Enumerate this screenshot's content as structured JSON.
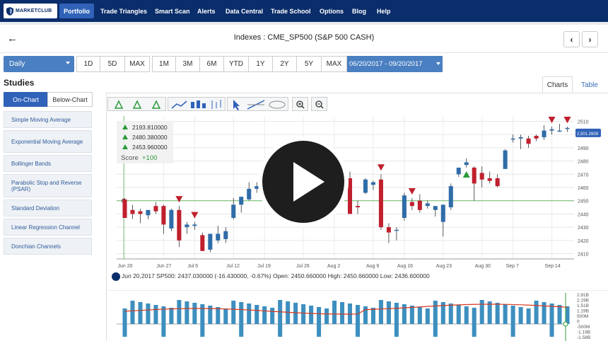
{
  "nav": {
    "logo": "MARKETCLUB",
    "items": [
      {
        "label": "Portfolio",
        "active": true
      },
      {
        "label": "Trade Triangles",
        "active": false
      },
      {
        "label": "Smart Scan",
        "active": false
      },
      {
        "label": "Alerts",
        "active": false
      },
      {
        "label": "Data Central",
        "active": false
      },
      {
        "label": "Trade School",
        "active": false
      },
      {
        "label": "Options",
        "active": false
      },
      {
        "label": "Blog",
        "active": false
      },
      {
        "label": "Help",
        "active": false
      }
    ]
  },
  "header": {
    "back_icon": "←",
    "title": "Indexes : CME_SP500 (S&P 500 CASH)",
    "prev_icon": "‹",
    "next_icon": "›"
  },
  "period": {
    "selected": "Daily",
    "intraday": [
      "1D",
      "5D",
      "MAX"
    ],
    "ranges": [
      "1M",
      "3M",
      "6M",
      "YTD",
      "1Y",
      "2Y",
      "5Y",
      "MAX"
    ],
    "date_range": "06/20/2017 - 09/20/2017"
  },
  "studies": {
    "title": "Studies",
    "tabs": [
      "On-Chart",
      "Below-Chart"
    ],
    "items": [
      "Simple Moving Average",
      "Exponential Moving Average",
      "Bollinger Bands",
      "Parabolic Stop and Reverse (PSAR)",
      "Standard Deviation",
      "Linear Regression Channel",
      "Donchian Channels"
    ]
  },
  "views": {
    "charts": "Charts",
    "table": "Table"
  },
  "legend": {
    "values": [
      "2193.810000",
      "2480.380000",
      "2453.960000"
    ],
    "score_label": "Score",
    "score_value": "+100"
  },
  "info_line": "Jun 20,2017 SP500: 2437.030000 (-16.430000, -0.67%) Open: 2450.660000 High: 2450.660000 Low: 2436.600000",
  "colors": {
    "nav_bg": "#0a2d6b",
    "accent": "#2f62b8",
    "select_bg": "#4a7fc1",
    "up": "#2f6da8",
    "down": "#c0202e",
    "signal_green": "#2c9a3a"
  },
  "chart_data": {
    "type": "candlestick",
    "x_ticks": [
      "Jun 20",
      "Jun 27",
      "Jul 5",
      "Jul 12",
      "Jul 19",
      "Jul 26",
      "Aug 2",
      "Aug 9",
      "Aug 16",
      "Aug 23",
      "Aug 30",
      "Sep 7",
      "Sep 14"
    ],
    "y_ticks": [
      2410,
      2420,
      2430,
      2440,
      2450,
      2460,
      2470,
      2480,
      2490,
      2500,
      2510
    ],
    "ylim": [
      2406,
      2514
    ],
    "last_price_label": "2,501.2609",
    "horizontal_line": 2450,
    "candles": [
      {
        "o": 2451,
        "h": 2452,
        "l": 2437,
        "c": 2437
      },
      {
        "o": 2443,
        "h": 2447,
        "l": 2436,
        "c": 2440
      },
      {
        "o": 2442,
        "h": 2444,
        "l": 2433,
        "c": 2440
      },
      {
        "o": 2439,
        "h": 2441,
        "l": 2436,
        "c": 2443
      },
      {
        "o": 2446,
        "h": 2449,
        "l": 2440,
        "c": 2442
      },
      {
        "o": 2446,
        "h": 2447,
        "l": 2425,
        "c": 2432
      },
      {
        "o": 2429,
        "h": 2444,
        "l": 2427,
        "c": 2443
      },
      {
        "o": 2443,
        "h": 2446,
        "l": 2415,
        "c": 2420
      },
      {
        "o": 2430,
        "h": 2434,
        "l": 2425,
        "c": 2432
      },
      {
        "o": 2431,
        "h": 2434,
        "l": 2428,
        "c": 2432
      },
      {
        "o": 2424,
        "h": 2426,
        "l": 2412,
        "c": 2412
      },
      {
        "o": 2413,
        "h": 2425,
        "l": 2411,
        "c": 2425
      },
      {
        "o": 2420,
        "h": 2431,
        "l": 2418,
        "c": 2425
      },
      {
        "o": 2421,
        "h": 2430,
        "l": 2418,
        "c": 2427
      },
      {
        "o": 2437,
        "h": 2452,
        "l": 2436,
        "c": 2447
      },
      {
        "o": 2447,
        "h": 2452,
        "l": 2441,
        "c": 2453
      },
      {
        "o": 2451,
        "h": 2464,
        "l": 2450,
        "c": 2459
      },
      {
        "o": 2459,
        "h": 2464,
        "l": 2456,
        "c": 2461
      },
      {
        "o": 2465,
        "h": 2468,
        "l": 2461,
        "c": 2462
      },
      {
        "o": 2462,
        "h": 2475,
        "l": 2460,
        "c": 2473
      },
      {
        "o": 2470,
        "h": 2481,
        "l": 2468,
        "c": 2477
      },
      {
        "o": 2476,
        "h": 2478,
        "l": 2468,
        "c": 2470
      },
      {
        "o": 2479,
        "h": 2483,
        "l": 2475,
        "c": 2477
      },
      {
        "o": 2477,
        "h": 2479,
        "l": 2470,
        "c": 2472
      },
      {
        "o": 2476,
        "h": 2478,
        "l": 2471,
        "c": 2477
      },
      {
        "o": 2477,
        "h": 2481,
        "l": 2474,
        "c": 2476
      },
      {
        "o": 2480,
        "h": 2487,
        "l": 2473,
        "c": 2477
      },
      {
        "o": 2474,
        "h": 2476,
        "l": 2464,
        "c": 2474
      },
      {
        "o": 2466,
        "h": 2473,
        "l": 2462,
        "c": 2468
      },
      {
        "o": 2467,
        "h": 2472,
        "l": 2447,
        "c": 2440
      },
      {
        "o": 2446,
        "h": 2450,
        "l": 2440,
        "c": 2445
      },
      {
        "o": 2456,
        "h": 2467,
        "l": 2455,
        "c": 2466
      },
      {
        "o": 2462,
        "h": 2465,
        "l": 2458,
        "c": 2464
      },
      {
        "o": 2466,
        "h": 2470,
        "l": 2428,
        "c": 2430
      },
      {
        "o": 2430,
        "h": 2433,
        "l": 2418,
        "c": 2426
      },
      {
        "o": 2428,
        "h": 2430,
        "l": 2420,
        "c": 2428
      },
      {
        "o": 2437,
        "h": 2456,
        "l": 2435,
        "c": 2454
      },
      {
        "o": 2449,
        "h": 2452,
        "l": 2443,
        "c": 2446
      },
      {
        "o": 2450,
        "h": 2455,
        "l": 2441,
        "c": 2443
      },
      {
        "o": 2446,
        "h": 2450,
        "l": 2444,
        "c": 2448
      },
      {
        "o": 2443,
        "h": 2445,
        "l": 2438,
        "c": 2446
      },
      {
        "o": 2434,
        "h": 2438,
        "l": 2423,
        "c": 2447
      },
      {
        "o": 2445,
        "h": 2463,
        "l": 2443,
        "c": 2461
      },
      {
        "o": 2470,
        "h": 2475,
        "l": 2468,
        "c": 2475
      },
      {
        "o": 2477,
        "h": 2482,
        "l": 2475,
        "c": 2479
      },
      {
        "o": 2475,
        "h": 2476,
        "l": 2450,
        "c": 2463
      },
      {
        "o": 2471,
        "h": 2476,
        "l": 2460,
        "c": 2466
      },
      {
        "o": 2467,
        "h": 2472,
        "l": 2463,
        "c": 2465
      },
      {
        "o": 2467,
        "h": 2470,
        "l": 2460,
        "c": 2461
      },
      {
        "o": 2474,
        "h": 2489,
        "l": 2474,
        "c": 2488
      },
      {
        "o": 2497,
        "h": 2500,
        "l": 2494,
        "c": 2497
      },
      {
        "o": 2497,
        "h": 2500,
        "l": 2489,
        "c": 2498
      },
      {
        "o": 2497,
        "h": 2499,
        "l": 2490,
        "c": 2493
      },
      {
        "o": 2499,
        "h": 2500,
        "l": 2495,
        "c": 2497
      },
      {
        "o": 2498,
        "h": 2507,
        "l": 2496,
        "c": 2503
      },
      {
        "o": 2503,
        "h": 2506,
        "l": 2500,
        "c": 2504
      },
      {
        "o": 2503,
        "h": 2508,
        "l": 2502,
        "c": 2503
      },
      {
        "o": 2505,
        "h": 2506,
        "l": 2502,
        "c": 2505
      }
    ],
    "volume_axis_ticks": [
      "2.91B",
      "2.19B",
      "1.51B",
      "1.19B",
      "500M",
      "0",
      "-500M",
      "-1.19B",
      "-1.58B"
    ]
  }
}
